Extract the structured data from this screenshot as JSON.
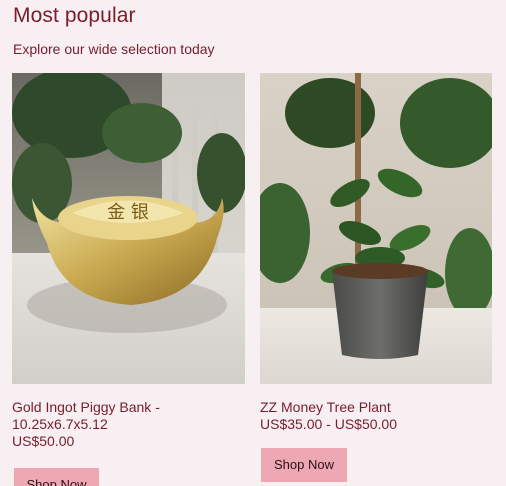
{
  "section": {
    "title": "Most popular",
    "subtitle": "Explore our wide selection today"
  },
  "products": [
    {
      "name": "Gold Ingot Piggy Bank - 10.25x6.7x5.12",
      "price": "US$50.00",
      "button": "Shop Now",
      "image_icon": "gold-ingot-photo"
    },
    {
      "name": "ZZ Money Tree Plant",
      "price": "US$35.00 - US$50.00",
      "button": "Shop Now",
      "image_icon": "zz-plant-photo"
    }
  ],
  "colors": {
    "background": "#f7eff1",
    "text": "#7a1c2c",
    "button": "#eda8b3"
  }
}
